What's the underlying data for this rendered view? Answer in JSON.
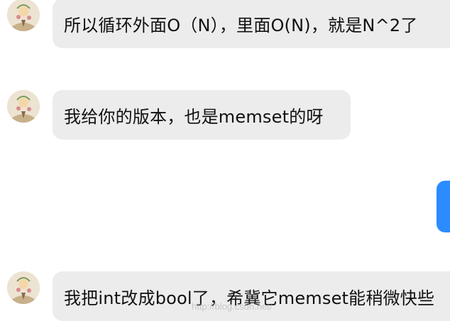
{
  "messages": [
    {
      "sender": "other",
      "avatar_icon": "flower-avatar-icon",
      "text": "所以循环外面O（N），里面O(N)，就是N^2了"
    },
    {
      "sender": "other",
      "avatar_icon": "flower-avatar-icon",
      "text": "我给你的版本，也是memset的呀"
    },
    {
      "sender": "self",
      "text": ""
    },
    {
      "sender": "other",
      "avatar_icon": "flower-avatar-icon",
      "text": "我把int改成bool了，希冀它memset能稍微快些"
    }
  ],
  "watermark": "http://blog.csdn.net/",
  "colors": {
    "incoming_bubble": "#ececec",
    "outgoing_bubble": "#2b8cff",
    "text": "#111111",
    "background": "#ffffff"
  }
}
